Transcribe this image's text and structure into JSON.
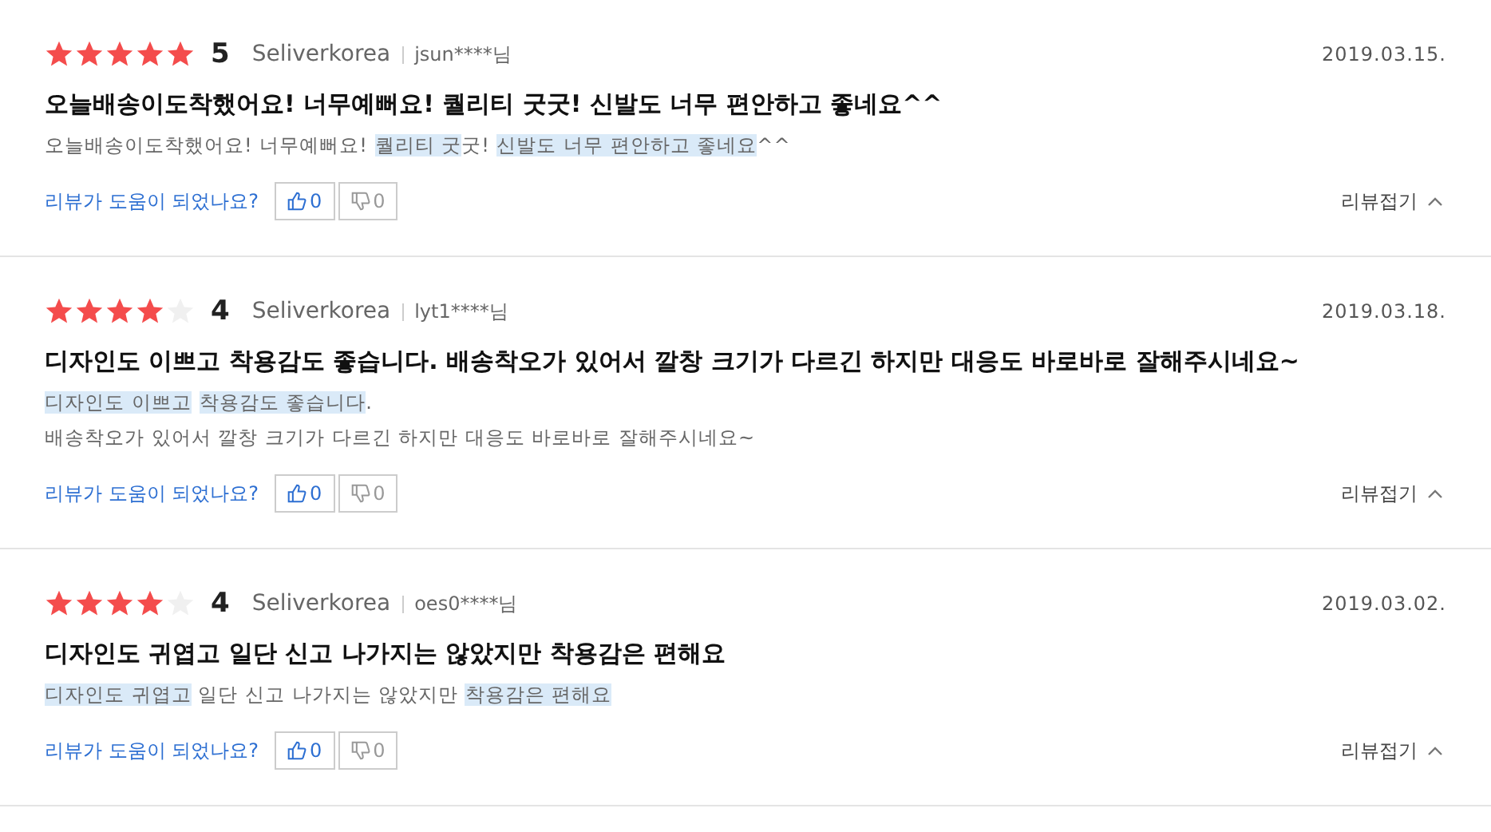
{
  "reviews": [
    {
      "stars": 5,
      "score": "5",
      "seller": "Seliverkorea",
      "user": "jsun****님",
      "date": "2019.03.15.",
      "title": "오늘배송이도착했어요! 너무예뻐요! 퀄리티 굿굿! 신발도 너무 편안하고 좋네요^^",
      "body": [
        [
          {
            "text": "오늘배송이도착했어요! 너무예뻐요! ",
            "highlighted": false
          },
          {
            "text": "퀄리티 굿",
            "highlighted": true
          },
          {
            "text": "굿! ",
            "highlighted": false
          },
          {
            "text": "신발도 너무 편안하고 좋네요",
            "highlighted": true
          },
          {
            "text": "^^",
            "highlighted": false
          }
        ]
      ],
      "helpful_prompt": "리뷰가 도움이 되었나요?",
      "likes": "0",
      "dislikes": "0",
      "collapse": "리뷰접기"
    },
    {
      "stars": 4,
      "score": "4",
      "seller": "Seliverkorea",
      "user": "lyt1****님",
      "date": "2019.03.18.",
      "title": "디자인도 이쁘고 착용감도 좋습니다. 배송착오가 있어서 깔창 크기가 다르긴 하지만 대응도 바로바로 잘해주시네요~",
      "body": [
        [
          {
            "text": "디자인도 이쁘고",
            "highlighted": true
          },
          {
            "text": "착용감도 좋습니다",
            "highlighted": true
          },
          {
            "text": ".",
            "highlighted": false
          }
        ],
        [
          {
            "text": "배송착오가 있어서 깔창 크기가 다르긴 하지만 대응도 바로바로 잘해주시네요~",
            "highlighted": false
          }
        ]
      ],
      "helpful_prompt": "리뷰가 도움이 되었나요?",
      "likes": "0",
      "dislikes": "0",
      "collapse": "리뷰접기"
    },
    {
      "stars": 4,
      "score": "4",
      "seller": "Seliverkorea",
      "user": "oes0****님",
      "date": "2019.03.02.",
      "title": "디자인도 귀엽고 일단 신고 나가지는 않았지만 착용감은 편해요",
      "body": [
        [
          {
            "text": "디자인도 귀엽고",
            "highlighted": true
          },
          {
            "text": " 일단 신고 나가지는 않았지만 ",
            "highlighted": false
          },
          {
            "text": "착용감은 편해요",
            "highlighted": true
          }
        ]
      ],
      "helpful_prompt": "리뷰가 도움이 되었나요?",
      "likes": "0",
      "dislikes": "0",
      "collapse": "리뷰접기"
    }
  ]
}
